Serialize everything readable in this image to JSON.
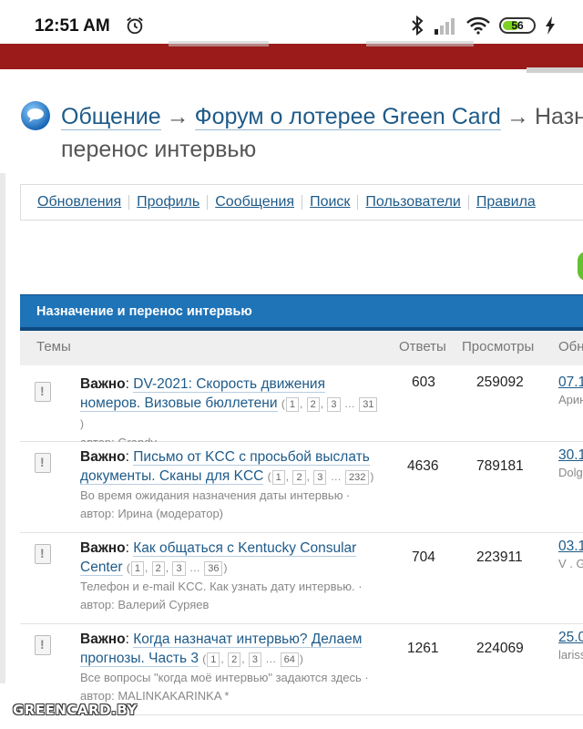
{
  "status_bar": {
    "time": "12:51 AM",
    "battery": "56"
  },
  "breadcrumb": {
    "items": [
      "Общение",
      "Форум о лотерее Green Card",
      "Назн"
    ],
    "current_line2": "перенос интервью",
    "arrow": "→"
  },
  "nav": [
    "Обновления",
    "Профиль",
    "Сообщения",
    "Поиск",
    "Пользователи",
    "Правила"
  ],
  "forum": {
    "title": "Назначение и перенос интервью",
    "columns": {
      "topics": "Темы",
      "replies": "Ответы",
      "views": "Просмотры",
      "last": "Обн"
    }
  },
  "topics": [
    {
      "prefix": "Важно",
      "title_a": "DV-2021: Скорость движения",
      "title_b": "номеров. Визовые бюллетени",
      "pages": [
        "1",
        "2",
        "3",
        "31"
      ],
      "desc": "",
      "author": "автор: Grandy",
      "replies": "603",
      "views": "259092",
      "last_date": "07.1",
      "last_user": "Арин"
    },
    {
      "prefix": "Важно",
      "title_a": "Письмо от KCC с просьбой выслать",
      "title_b": "документы. Сканы для KCC",
      "pages": [
        "1",
        "2",
        "3",
        "232"
      ],
      "desc": "Во время ожидания назначения даты интервью ·",
      "author": "автор: Ирина (модератор)",
      "replies": "4636",
      "views": "789181",
      "last_date": "30.1",
      "last_user": "Dolg"
    },
    {
      "prefix": "Важно",
      "title_a": "Как общаться с Kentucky Consular",
      "title_b": "Center",
      "pages": [
        "1",
        "2",
        "3",
        "36"
      ],
      "desc": "Телефон и e-mail KCC. Как узнать дату интервью. ·",
      "author": "автор: Валерий Суряев",
      "replies": "704",
      "views": "223911",
      "last_date": "03.1",
      "last_user": "V . G"
    },
    {
      "prefix": "Важно",
      "title_a": "Когда назначат интервью? Делаем",
      "title_b": "прогнозы. Часть 3",
      "pages": [
        "1",
        "2",
        "3",
        "64"
      ],
      "desc": "Все вопросы \"когда моё интервью\" задаются здесь ·",
      "author": "автор: MALINKAKARINKA *",
      "replies": "1261",
      "views": "224069",
      "last_date": "25.0",
      "last_user": "lariss"
    }
  ],
  "watermark": "GREENCARD.BY",
  "colors": {
    "header_red": "#9b1b1b",
    "forum_blue": "#1f73b7",
    "link": "#1e5b8a",
    "battery_green": "#7ed321"
  }
}
